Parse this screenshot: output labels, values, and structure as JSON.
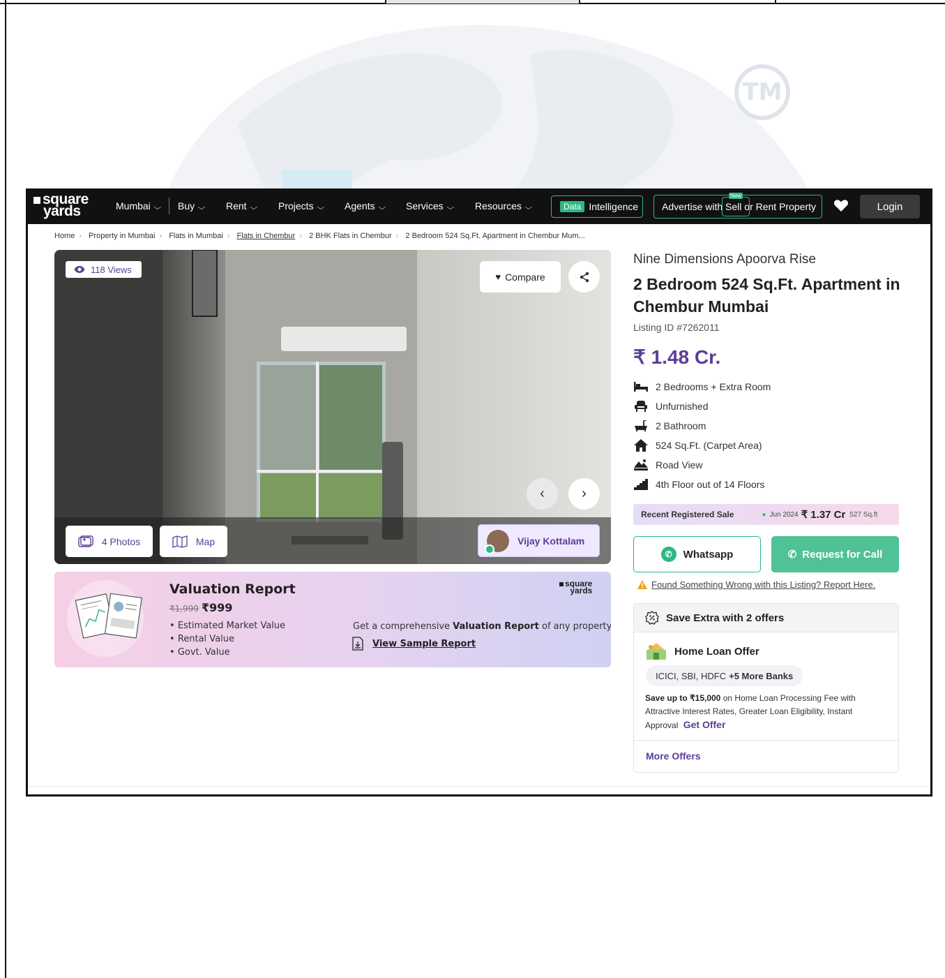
{
  "nav": {
    "logo_line1": "square",
    "logo_line2": "yards",
    "city": "Mumbai",
    "items": [
      "Buy",
      "Rent",
      "Projects",
      "Agents",
      "Services",
      "Resources"
    ],
    "data_tag": "Data",
    "data_label": "Intelligence",
    "advertise_label": "Advertise with",
    "sell_label": "Sell or Rent Property",
    "new_badge": "New",
    "login_label": "Login"
  },
  "breadcrumb": [
    "Home",
    "Property in Mumbai",
    "Flats in Mumbai",
    "Flats in Chembur",
    "2 BHK Flats in Chembur",
    "2 Bedroom 524 Sq.Ft. Apartment in Chembur Mum..."
  ],
  "gallery": {
    "views": "118 Views",
    "compare_label": "Compare",
    "photos_label": "4 Photos",
    "map_label": "Map",
    "agent_name": "Vijay Kottalam"
  },
  "valuation": {
    "title": "Valuation Report",
    "old_price": "₹1,999",
    "price": "₹999",
    "points": [
      "Estimated Market Value",
      "Rental Value",
      "Govt. Value"
    ],
    "desc_pre": "Get a comprehensive ",
    "desc_bold": "Valuation Report",
    "desc_post": " of any property",
    "link_label": "View Sample Report",
    "logo_line1": "square",
    "logo_line2": "yards"
  },
  "listing": {
    "project": "Nine Dimensions Apoorva Rise",
    "title": "2 Bedroom 524 Sq.Ft. Apartment in Chembur Mumbai",
    "listing_id": "Listing ID #7262011",
    "price": "₹ 1.48 Cr.",
    "features": [
      {
        "icon": "bed-icon",
        "text": "2 Bedrooms + Extra Room"
      },
      {
        "icon": "sofa-icon",
        "text": "Unfurnished"
      },
      {
        "icon": "bathtub-icon",
        "text": "2 Bathroom"
      },
      {
        "icon": "home-icon",
        "text": "524 Sq.Ft. (Carpet Area)"
      },
      {
        "icon": "road-view-icon",
        "text": "Road View"
      },
      {
        "icon": "stairs-icon",
        "text": "4th Floor out of 14 Floors"
      }
    ]
  },
  "recent_sale": {
    "label": "Recent Registered Sale",
    "date": "Jun 2024",
    "amount": "₹ 1.37 Cr",
    "area": "527 Sq.ft"
  },
  "actions": {
    "whatsapp_label": "Whatsapp",
    "call_label": "Request for Call",
    "report_label": "Found Something Wrong with this Listing? Report Here."
  },
  "offers": {
    "header": "Save Extra with 2 offers",
    "loan_title": "Home Loan Offer",
    "banks": "ICICI, SBI, HDFC",
    "banks_more": "+5 More Banks",
    "desc_bold": "Save up to ₹15,000",
    "desc": " on Home Loan Processing Fee with Attractive Interest Rates, Greater Loan Eligibility, Instant Approval",
    "get_offer": "Get Offer",
    "more_offers": "More Offers"
  },
  "watermark": {
    "mark": "TM"
  },
  "colors": {
    "brand_purple": "#5b3e96",
    "accent_green": "#2eb882",
    "nav_bg": "#111111"
  }
}
